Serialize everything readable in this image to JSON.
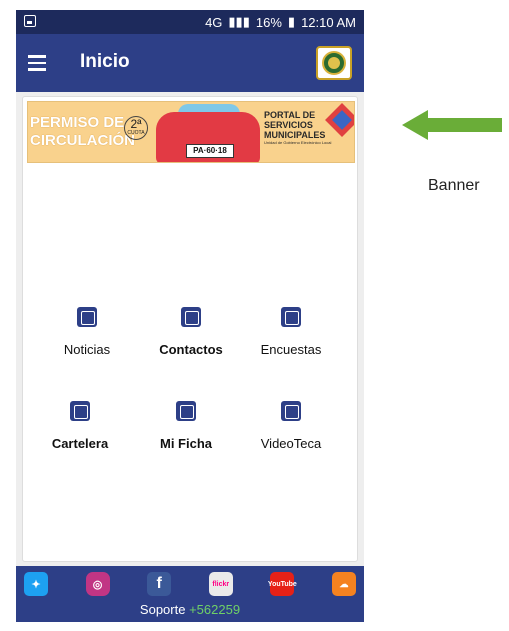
{
  "status_bar": {
    "network": "4G",
    "battery": "16%",
    "time": "12:10 AM"
  },
  "app_bar": {
    "title": "Inicio",
    "menu_icon": "hamburger-icon",
    "logo": "municipal-seal-logo"
  },
  "banner": {
    "left_text": "PERMISO DE CIRCULACIÓN",
    "quota_number": "2ª",
    "quota_label": "CUOTA",
    "plate": "PA·60·18",
    "portal_title": "PORTAL DE SERVICIOS MUNICIPALES",
    "portal_subtitle": "Unidad de Gobierno Electrónico Local"
  },
  "menu": {
    "items": [
      {
        "label": "Noticias",
        "icon": "newspaper-icon"
      },
      {
        "label": "Contactos",
        "icon": "contacts-book-icon"
      },
      {
        "label": "Encuestas",
        "icon": "survey-clipboard-icon"
      },
      {
        "label": "Cartelera",
        "icon": "calendar-board-icon"
      },
      {
        "label": "Mi Ficha",
        "icon": "profile-card-icon"
      },
      {
        "label": "VideoTeca",
        "icon": "video-play-icon"
      }
    ]
  },
  "footer": {
    "social": [
      "Twitter",
      "Instagram",
      "Facebook",
      "flickr",
      "YouTube",
      "SoundCloud"
    ],
    "support_label": "Soporte",
    "support_phone": "+562259"
  },
  "annotation": {
    "label": "Banner"
  },
  "colors": {
    "app_bar": "#2d3f87",
    "status_bar": "#1d2a5c",
    "arrow": "#6aad38"
  }
}
